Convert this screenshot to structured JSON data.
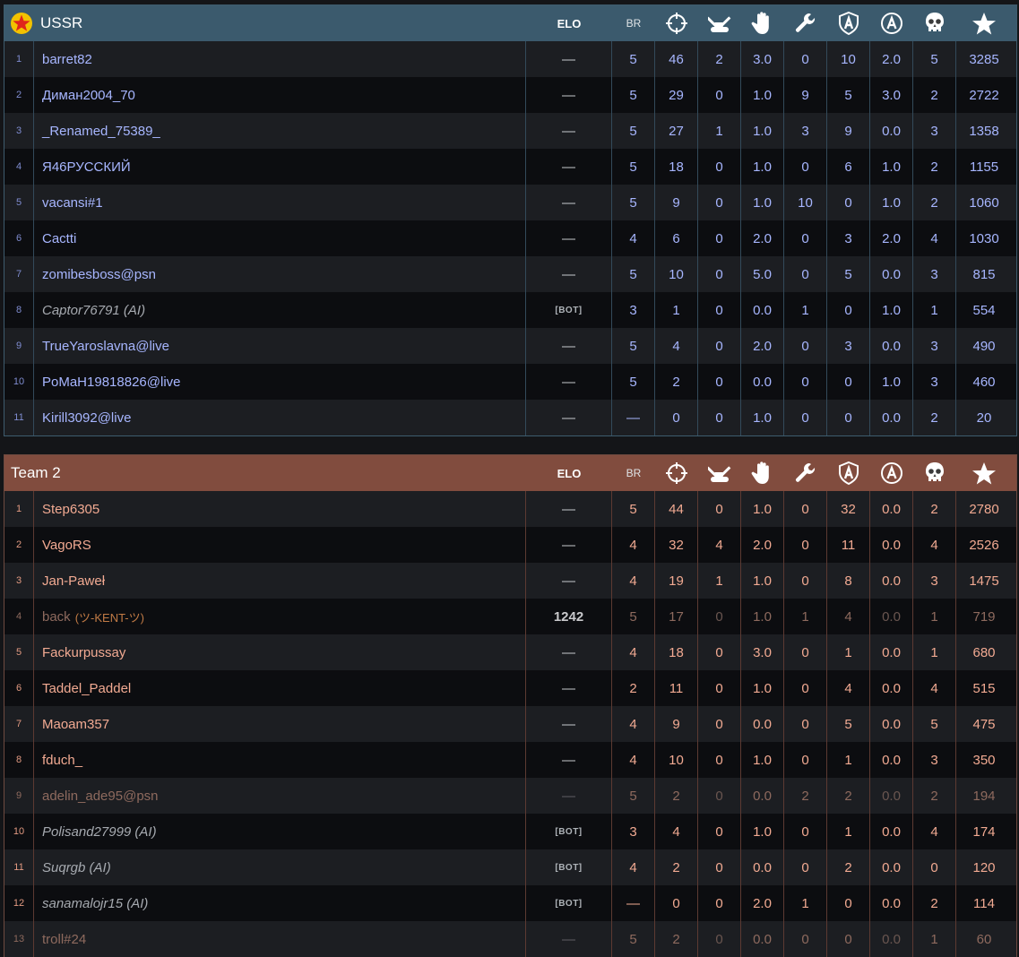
{
  "columns": {
    "elo": "ELO",
    "br": "BR",
    "icons": [
      "crosshair-icon",
      "ground-kill-icon",
      "assist-icon",
      "wrench-icon",
      "capture-shield-icon",
      "a-circle-icon",
      "skull-icon",
      "star-icon"
    ]
  },
  "team1": {
    "name": "USSR",
    "accent": "#3b5a6d",
    "rows": [
      {
        "n": "1",
        "name": "barret82",
        "elo": "—",
        "br": "5",
        "s1": "46",
        "s2": "2",
        "s3": "3.0",
        "s4": "0",
        "s5": "10",
        "s6": "2.0",
        "s7": "5",
        "score": "3285"
      },
      {
        "n": "2",
        "name": "Диман2004_70",
        "elo": "—",
        "br": "5",
        "s1": "29",
        "s2": "0",
        "s3": "1.0",
        "s4": "9",
        "s5": "5",
        "s6": "3.0",
        "s7": "2",
        "score": "2722"
      },
      {
        "n": "3",
        "name": "_Renamed_75389_",
        "elo": "—",
        "br": "5",
        "s1": "27",
        "s2": "1",
        "s3": "1.0",
        "s4": "3",
        "s5": "9",
        "s6": "0.0",
        "s7": "3",
        "score": "1358"
      },
      {
        "n": "4",
        "name": "Я46РУССКИЙ",
        "elo": "—",
        "br": "5",
        "s1": "18",
        "s2": "0",
        "s3": "1.0",
        "s4": "0",
        "s5": "6",
        "s6": "1.0",
        "s7": "2",
        "score": "1155"
      },
      {
        "n": "5",
        "name": "vacansi#1",
        "elo": "—",
        "br": "5",
        "s1": "9",
        "s2": "0",
        "s3": "1.0",
        "s4": "10",
        "s5": "0",
        "s6": "1.0",
        "s7": "2",
        "score": "1060"
      },
      {
        "n": "6",
        "name": "Cactti",
        "elo": "—",
        "br": "4",
        "s1": "6",
        "s2": "0",
        "s3": "2.0",
        "s4": "0",
        "s5": "3",
        "s6": "2.0",
        "s7": "4",
        "score": "1030"
      },
      {
        "n": "7",
        "name": "zomibesboss@psn",
        "elo": "—",
        "br": "5",
        "s1": "10",
        "s2": "0",
        "s3": "5.0",
        "s4": "0",
        "s5": "5",
        "s6": "0.0",
        "s7": "3",
        "score": "815"
      },
      {
        "n": "8",
        "name": "Captor76791 (AI)",
        "elo": "[BOT]",
        "br": "3",
        "s1": "1",
        "s2": "0",
        "s3": "0.0",
        "s4": "1",
        "s5": "0",
        "s6": "1.0",
        "s7": "1",
        "score": "554"
      },
      {
        "n": "9",
        "name": "TrueYaroslavna@live",
        "elo": "—",
        "br": "5",
        "s1": "4",
        "s2": "0",
        "s3": "2.0",
        "s4": "0",
        "s5": "3",
        "s6": "0.0",
        "s7": "3",
        "score": "490"
      },
      {
        "n": "10",
        "name": "PoMaH19818826@live",
        "elo": "—",
        "br": "5",
        "s1": "2",
        "s2": "0",
        "s3": "0.0",
        "s4": "0",
        "s5": "0",
        "s6": "1.0",
        "s7": "3",
        "score": "460"
      },
      {
        "n": "11",
        "name": "Kirill3092@live",
        "elo": "—",
        "br": "—",
        "s1": "0",
        "s2": "0",
        "s3": "1.0",
        "s4": "0",
        "s5": "0",
        "s6": "0.0",
        "s7": "2",
        "score": "20"
      }
    ]
  },
  "team2": {
    "name": "Team 2",
    "accent": "#814c3e",
    "rows": [
      {
        "n": "1",
        "name": "Step6305",
        "elo": "—",
        "br": "5",
        "s1": "44",
        "s2": "0",
        "s3": "1.0",
        "s4": "0",
        "s5": "32",
        "s6": "0.0",
        "s7": "2",
        "score": "2780"
      },
      {
        "n": "2",
        "name": "VagoRS",
        "elo": "—",
        "br": "4",
        "s1": "32",
        "s2": "4",
        "s3": "2.0",
        "s4": "0",
        "s5": "11",
        "s6": "0.0",
        "s7": "4",
        "score": "2526"
      },
      {
        "n": "3",
        "name": "Jan-Paweł",
        "elo": "—",
        "br": "4",
        "s1": "19",
        "s2": "1",
        "s3": "1.0",
        "s4": "0",
        "s5": "8",
        "s6": "0.0",
        "s7": "3",
        "score": "1475"
      },
      {
        "n": "4",
        "name": "back",
        "squad": "(ツ-KENT-ツ)",
        "elo": "1242",
        "br": "5",
        "s1": "17",
        "s2": "0",
        "s3": "1.0",
        "s4": "1",
        "s5": "4",
        "s6": "0.0",
        "s7": "1",
        "score": "719"
      },
      {
        "n": "5",
        "name": "Fackurpussay",
        "elo": "—",
        "br": "4",
        "s1": "18",
        "s2": "0",
        "s3": "3.0",
        "s4": "0",
        "s5": "1",
        "s6": "0.0",
        "s7": "1",
        "score": "680"
      },
      {
        "n": "6",
        "name": "Taddel_Paddel",
        "elo": "—",
        "br": "2",
        "s1": "11",
        "s2": "0",
        "s3": "1.0",
        "s4": "0",
        "s5": "4",
        "s6": "0.0",
        "s7": "4",
        "score": "515"
      },
      {
        "n": "7",
        "name": "Maoam357",
        "elo": "—",
        "br": "4",
        "s1": "9",
        "s2": "0",
        "s3": "0.0",
        "s4": "0",
        "s5": "5",
        "s6": "0.0",
        "s7": "5",
        "score": "475"
      },
      {
        "n": "8",
        "name": "fduch_",
        "elo": "—",
        "br": "4",
        "s1": "10",
        "s2": "0",
        "s3": "1.0",
        "s4": "0",
        "s5": "1",
        "s6": "0.0",
        "s7": "3",
        "score": "350"
      },
      {
        "n": "9",
        "name": "adelin_ade95@psn",
        "elo": "—",
        "br": "5",
        "s1": "2",
        "s2": "0",
        "s3": "0.0",
        "s4": "2",
        "s5": "2",
        "s6": "0.0",
        "s7": "2",
        "score": "194"
      },
      {
        "n": "10",
        "name": "Polisand27999 (AI)",
        "elo": "[BOT]",
        "br": "3",
        "s1": "4",
        "s2": "0",
        "s3": "1.0",
        "s4": "0",
        "s5": "1",
        "s6": "0.0",
        "s7": "4",
        "score": "174"
      },
      {
        "n": "11",
        "name": "Suqrgb (AI)",
        "elo": "[BOT]",
        "br": "4",
        "s1": "2",
        "s2": "0",
        "s3": "0.0",
        "s4": "0",
        "s5": "2",
        "s6": "0.0",
        "s7": "0",
        "score": "120"
      },
      {
        "n": "12",
        "name": "sanamalojr15 (AI)",
        "elo": "[BOT]",
        "br": "—",
        "s1": "0",
        "s2": "0",
        "s3": "2.0",
        "s4": "1",
        "s5": "0",
        "s6": "0.0",
        "s7": "2",
        "score": "114"
      },
      {
        "n": "13",
        "name": "troll#24",
        "elo": "—",
        "br": "5",
        "s1": "2",
        "s2": "0",
        "s3": "0.0",
        "s4": "0",
        "s5": "0",
        "s6": "0.0",
        "s7": "1",
        "score": "60"
      }
    ]
  }
}
